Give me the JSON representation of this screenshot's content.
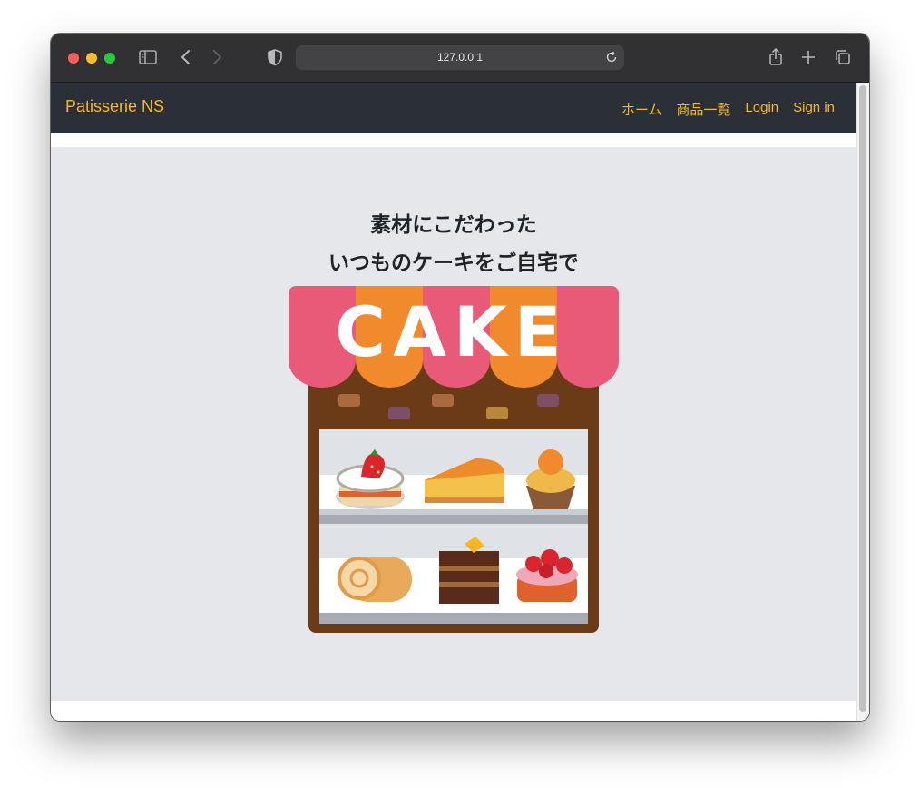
{
  "browser": {
    "url": "127.0.0.1"
  },
  "navbar": {
    "brand": "Patisserie NS",
    "links": [
      "ホーム",
      "商品一覧",
      "Login",
      "Sign in"
    ]
  },
  "hero": {
    "tagline_line1": "素材にこだわった",
    "tagline_line2": "いつものケーキをご自宅で",
    "sign_text": "CAKE"
  },
  "colors": {
    "accent": "#f5b820",
    "navbar_bg": "#2b2f38",
    "hero_bg": "#e5e7eb"
  }
}
